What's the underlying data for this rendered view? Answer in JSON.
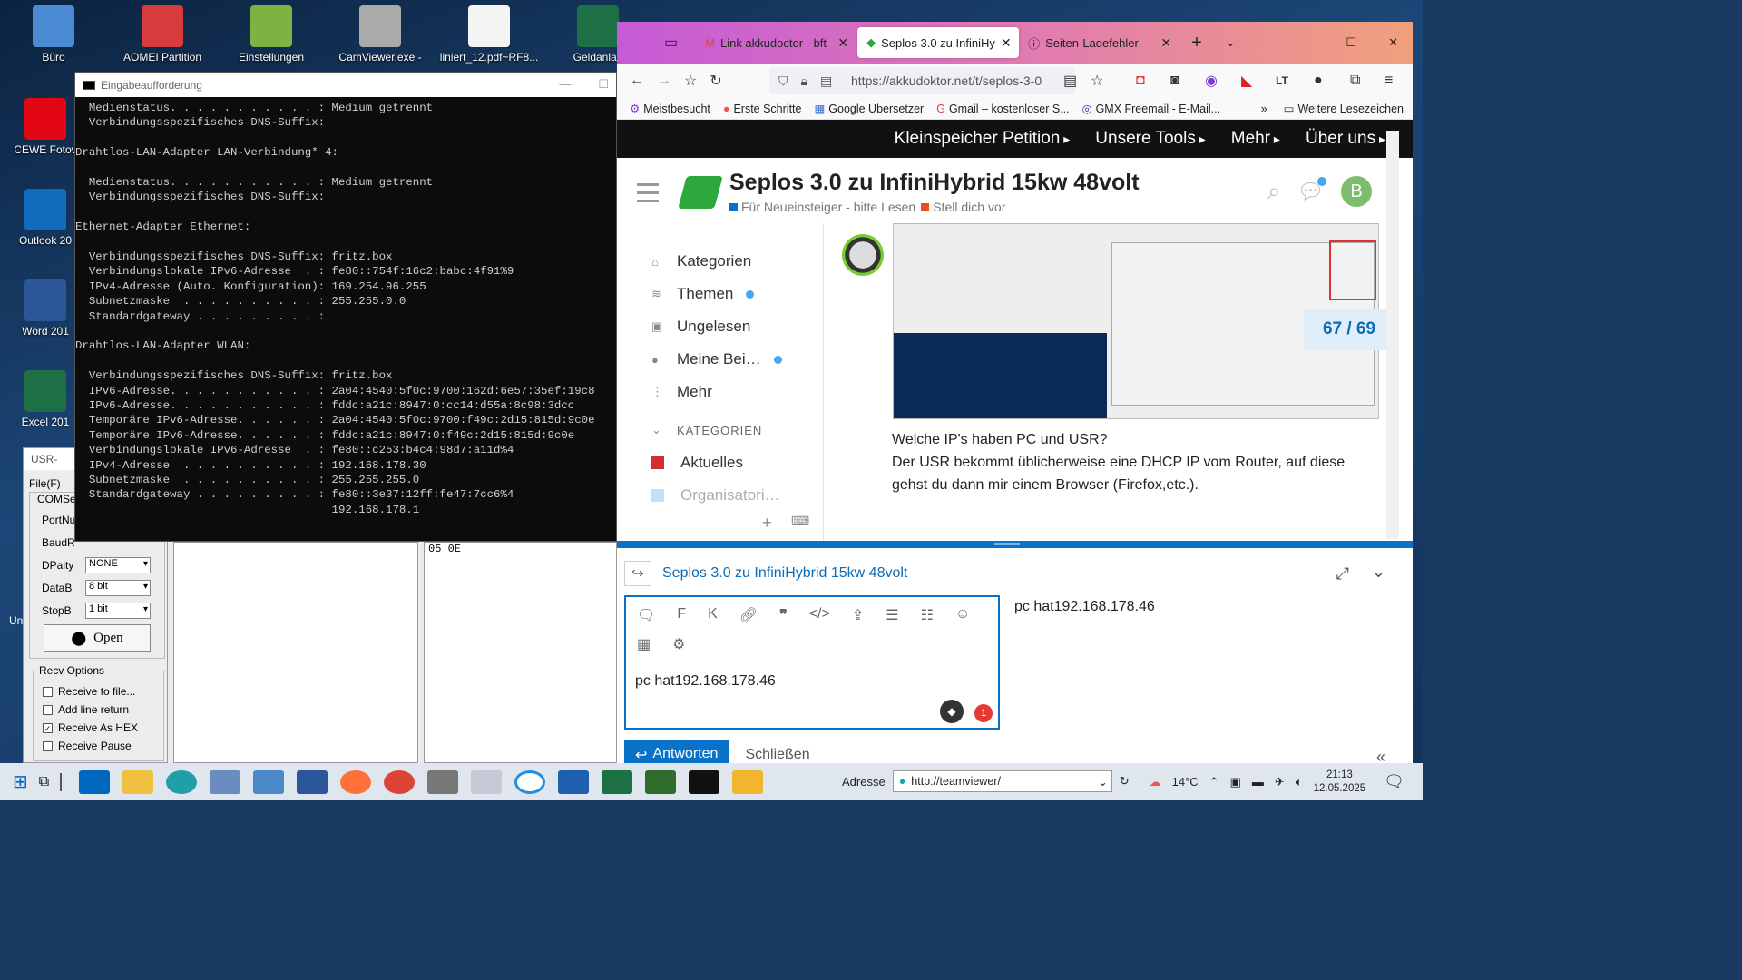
{
  "desktop": {
    "icons": [
      {
        "label": "Büro",
        "color": "#4a8bd4"
      },
      {
        "label": "AOMEI Partition",
        "color": "#d83b3b"
      },
      {
        "label": "Einstellungen",
        "color": "#7cb342"
      },
      {
        "label": "CamViewer.exe -",
        "color": "#aaaaaa"
      },
      {
        "label": "liniert_12.pdf~RF8...",
        "color": "#f4f4f4"
      },
      {
        "label": "Geldanlag",
        "color": "#1d7044"
      },
      {
        "label": "CEWE Fotov",
        "color": "#e30613"
      },
      {
        "label": "Outlook 20",
        "color": "#0f6cbd"
      },
      {
        "label": "Word 201",
        "color": "#2b579a"
      },
      {
        "label": "Excel 201",
        "color": "#1d7044"
      }
    ]
  },
  "cmd": {
    "title": "Eingabeaufforderung",
    "lines": [
      "  Medienstatus. . . . . . . . . . . : Medium getrennt",
      "  Verbindungsspezifisches DNS-Suffix:",
      "",
      "Drahtlos-LAN-Adapter LAN-Verbindung* 4:",
      "",
      "  Medienstatus. . . . . . . . . . . : Medium getrennt",
      "  Verbindungsspezifisches DNS-Suffix:",
      "",
      "Ethernet-Adapter Ethernet:",
      "",
      "  Verbindungsspezifisches DNS-Suffix: fritz.box",
      "  Verbindungslokale IPv6-Adresse  . : fe80::754f:16c2:babc:4f91%9",
      "  IPv4-Adresse (Auto. Konfiguration): 169.254.96.255",
      "  Subnetzmaske  . . . . . . . . . . : 255.255.0.0",
      "  Standardgateway . . . . . . . . . :",
      "",
      "Drahtlos-LAN-Adapter WLAN:",
      "",
      "  Verbindungsspezifisches DNS-Suffix: fritz.box",
      "  IPv6-Adresse. . . . . . . . . . . : 2a04:4540:5f0c:9700:162d:6e57:35ef:19c8",
      "  IPv6-Adresse. . . . . . . . . . . : fddc:a21c:8947:0:cc14:d55a:8c98:3dcc",
      "  Temporäre IPv6-Adresse. . . . . . : 2a04:4540:5f0c:9700:f49c:2d15:815d:9c0e",
      "  Temporäre IPv6-Adresse. . . . . . : fddc:a21c:8947:0:f49c:2d15:815d:9c0e",
      "  Verbindungslokale IPv6-Adresse  . : fe80::c253:b4c4:98d7:a11d%4",
      "  IPv4-Adresse  . . . . . . . . . . : 192.168.178.30",
      "  Subnetzmaske  . . . . . . . . . . : 255.255.255.0",
      "  Standardgateway . . . . . . . . . : fe80::3e37:12ff:fe47:7cc6%4",
      "                                      192.168.178.1"
    ]
  },
  "usr": {
    "title": "USR-",
    "menu": "File(F)",
    "group": "COMSe",
    "port": "PortNu",
    "baud": "BaudR",
    "dparity": "DPaity",
    "dparity_val": "NONE",
    "databits": "DataB",
    "databits_val": "8 bit",
    "stopbits": "StopB",
    "stopbits_val": "1 bit",
    "open": "Open",
    "recv_title": "Recv Options",
    "recv": [
      "Receive to file...",
      "Add line return",
      "Receive As HEX",
      "Receive Pause"
    ],
    "recv_checked": [
      false,
      false,
      true,
      false
    ],
    "hex_val": "05 0E",
    "uni": "Un"
  },
  "browser": {
    "tabs": [
      {
        "label": "Link akkudoctor - bft"
      },
      {
        "label": "Seplos 3.0 zu InfiniHy"
      },
      {
        "label": "Seiten-Ladefehler"
      }
    ],
    "url": "https://akkudoktor.net/t/seplos-3-0",
    "bookmarks": [
      "Meistbesucht",
      "Erste Schritte",
      "Google Übersetzer",
      "Gmail – kostenloser S...",
      "GMX Freemail - E-Mail..."
    ],
    "more_bookmarks": "Weitere Lesezeichen",
    "sitenav": [
      "Kleinspeicher Petition",
      "Unsere Tools",
      "Mehr",
      "Über uns"
    ],
    "topic_title": "Seplos 3.0 zu InfiniHybrid 15kw 48volt",
    "categories": [
      {
        "label": "Für Neueinsteiger - bitte Lesen",
        "color": "#0a72c8"
      },
      {
        "label": "Stell dich vor",
        "color": "#ef4c23"
      }
    ],
    "avatar": "B",
    "sidebar": [
      {
        "label": "Kategorien",
        "icon": "⌂",
        "dot": false
      },
      {
        "label": "Themen",
        "icon": "≋",
        "dot": true
      },
      {
        "label": "Ungelesen",
        "icon": "▣",
        "dot": false
      },
      {
        "label": "Meine Bei…",
        "icon": "●",
        "dot": true
      },
      {
        "label": "Mehr",
        "icon": "⋮",
        "dot": false
      }
    ],
    "sidebar_section": "KATEGORIEN",
    "sidebar_cats": [
      {
        "label": "Aktuelles",
        "color": "#d32f2f"
      },
      {
        "label": "Organisatori…",
        "color": "#64b5f6"
      }
    ],
    "post_lines": [
      "Welche IP's haben PC und USR?",
      "Der USR bekommt üblicherweise eine DHCP IP vom Router, auf diese gehst du dann mir einem Browser (Firefox,etc.)."
    ],
    "progress": "67 / 69",
    "composer_title": "Seplos 3.0 zu InfiniHybrid 15kw 48volt",
    "toolbar": [
      "F",
      "K"
    ],
    "editor_text": "pc hat192.168.178.46",
    "preview_text": "pc hat192.168.178.46",
    "reply": "Antworten",
    "close": "Schließen",
    "badge": "1"
  },
  "taskbar": {
    "address_label": "Adresse",
    "address_value": "http://teamviewer/",
    "temp": "14°C",
    "time": "21:13",
    "date": "12.05.2025"
  }
}
